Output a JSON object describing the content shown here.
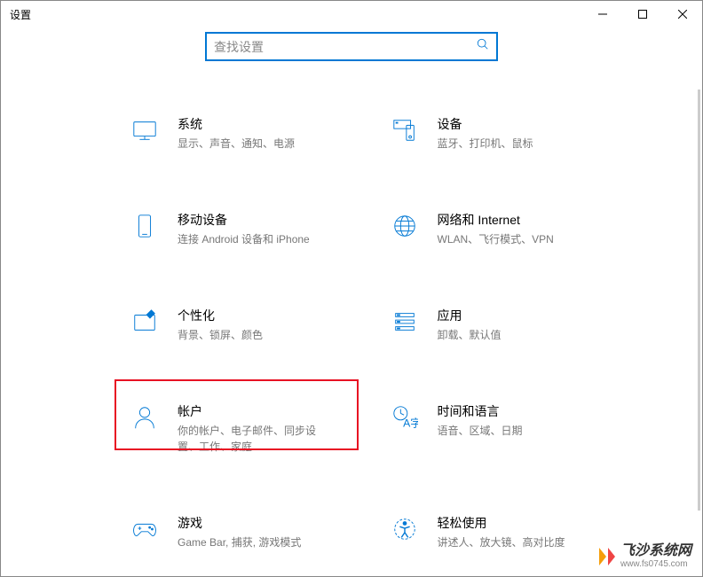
{
  "window": {
    "title": "设置"
  },
  "search": {
    "placeholder": "查找设置"
  },
  "items": [
    {
      "title": "系统",
      "desc": "显示、声音、通知、电源"
    },
    {
      "title": "设备",
      "desc": "蓝牙、打印机、鼠标"
    },
    {
      "title": "移动设备",
      "desc": "连接 Android 设备和 iPhone"
    },
    {
      "title": "网络和 Internet",
      "desc": "WLAN、飞行模式、VPN"
    },
    {
      "title": "个性化",
      "desc": "背景、锁屏、颜色"
    },
    {
      "title": "应用",
      "desc": "卸载、默认值"
    },
    {
      "title": "帐户",
      "desc": "你的帐户、电子邮件、同步设置、工作、家庭"
    },
    {
      "title": "时间和语言",
      "desc": "语音、区域、日期"
    },
    {
      "title": "游戏",
      "desc": "Game Bar, 捕获, 游戏模式"
    },
    {
      "title": "轻松使用",
      "desc": "讲述人、放大镜、高对比度"
    }
  ],
  "watermark": {
    "main": "飞沙系统网",
    "sub": "www.fs0745.com"
  }
}
